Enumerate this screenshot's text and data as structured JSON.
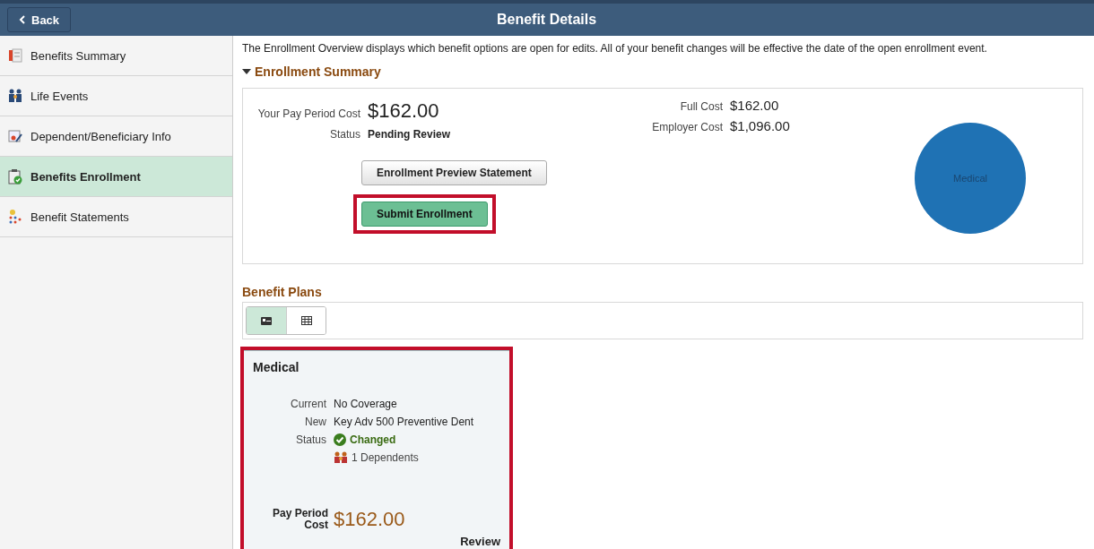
{
  "header": {
    "back_label": "Back",
    "title": "Benefit Details"
  },
  "sidebar": {
    "items": [
      {
        "label": "Benefits Summary",
        "selected": false
      },
      {
        "label": "Life Events",
        "selected": false
      },
      {
        "label": "Dependent/Beneficiary Info",
        "selected": false
      },
      {
        "label": "Benefits Enrollment",
        "selected": true
      },
      {
        "label": "Benefit Statements",
        "selected": false
      }
    ]
  },
  "intro": "The Enrollment Overview displays which benefit options are open for edits. All of your benefit changes will be effective the date of the open enrollment event.",
  "enrollment_summary": {
    "heading": "Enrollment Summary",
    "expanded": true,
    "pay_period_cost_label": "Your Pay Period Cost",
    "pay_period_cost": "$162.00",
    "status_label": "Status",
    "status": "Pending Review",
    "full_cost_label": "Full Cost",
    "full_cost": "$162.00",
    "employer_cost_label": "Employer Cost",
    "employer_cost": "$1,096.00",
    "buttons": [
      {
        "label": "Enrollment Preview Statement",
        "kind": "default",
        "highlighted": false
      },
      {
        "label": "Submit Enrollment",
        "kind": "primary",
        "highlighted": true
      }
    ],
    "cost_chart": {
      "slices": [
        {
          "label": "Medical"
        }
      ]
    }
  },
  "benefit_plans": {
    "heading": "Benefit Plans",
    "views": [
      {
        "selected": true
      },
      {
        "selected": false
      }
    ],
    "cards": [
      {
        "title": "Medical",
        "highlighted": true,
        "rows": [
          {
            "label": "Current",
            "value": "No Coverage"
          },
          {
            "label": "New",
            "value": "Key Adv 500 Preventive Dent"
          }
        ],
        "status_label": "Status",
        "status": "Changed",
        "dependents": "1 Dependents",
        "cost_label": "Pay Period Cost",
        "cost": "$162.00",
        "action": "Review"
      }
    ]
  }
}
